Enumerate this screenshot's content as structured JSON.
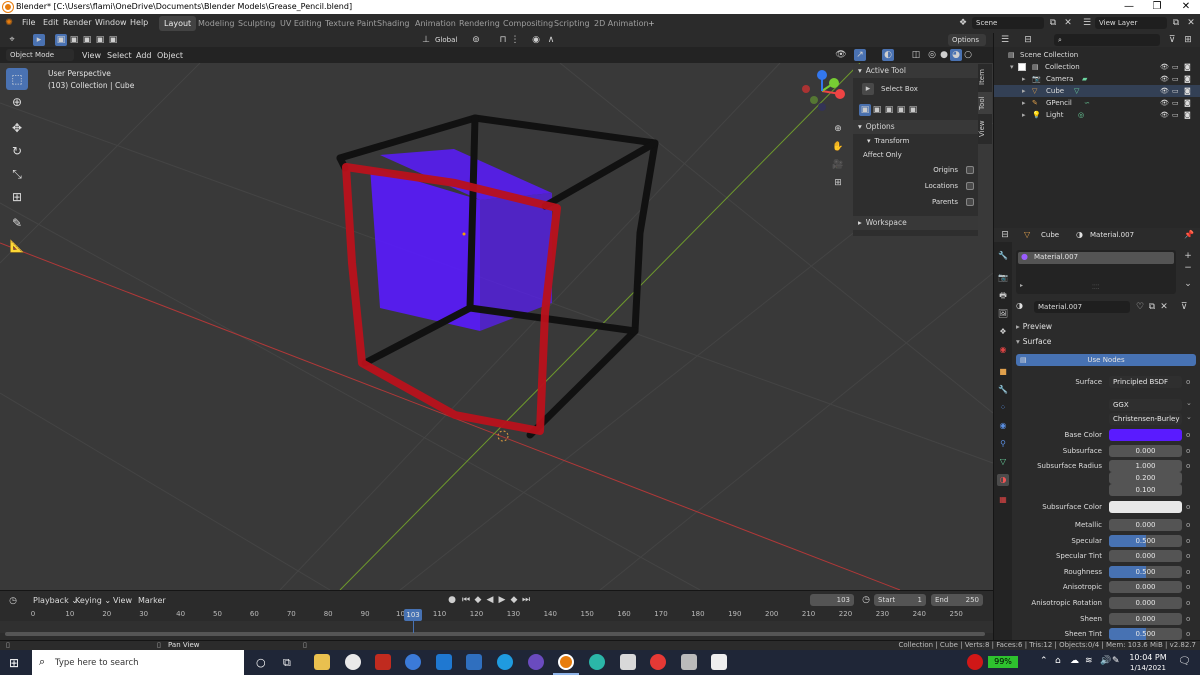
{
  "window": {
    "title": "Blender* [C:\\Users\\flami\\OneDrive\\Documents\\Blender Models\\Grease_Pencil.blend]",
    "controls": [
      "—",
      "❐",
      "✕"
    ]
  },
  "menu": [
    "File",
    "Edit",
    "Render",
    "Window",
    "Help"
  ],
  "workspaces": [
    "Layout",
    "Modeling",
    "Sculpting",
    "UV Editing",
    "Texture Paint",
    "Shading",
    "Animation",
    "Rendering",
    "Compositing",
    "Scripting",
    "2D Animation"
  ],
  "active_workspace": "Layout",
  "scene": {
    "name": "Scene",
    "view_layer": "View Layer"
  },
  "viewport": {
    "orientation": "Global",
    "options_label": "Options",
    "mode": "Object Mode",
    "header_menu": [
      "View",
      "Select",
      "Add",
      "Object"
    ],
    "info_line1": "User Perspective",
    "info_line2": "(103) Collection | Cube",
    "background": "#393939",
    "cube_color": "#5a1bff"
  },
  "toolbar_icons": [
    "select-box-icon",
    "cursor-icon",
    "move-icon",
    "rotate-icon",
    "scale-icon",
    "transform-icon",
    "annotate-icon",
    "measure-icon"
  ],
  "npanel": {
    "active_tool_label": "Active Tool",
    "select_box_label": "Select Box",
    "options_label": "Options",
    "transform_label": "Transform",
    "affect_only_label": "Affect Only",
    "origins_label": "Origins",
    "locations_label": "Locations",
    "parents_label": "Parents",
    "workspace_label": "Workspace",
    "tabs": [
      "Item",
      "Tool",
      "View"
    ]
  },
  "outliner": {
    "scene_collection": "Scene Collection",
    "collection": "Collection",
    "items": [
      {
        "name": "Camera",
        "icon": "camera-icon",
        "color": "#e0a04c"
      },
      {
        "name": "Cube",
        "icon": "mesh-icon",
        "color": "#e0a04c"
      },
      {
        "name": "GPencil",
        "icon": "grease-pencil-icon",
        "color": "#e0a04c"
      },
      {
        "name": "Light",
        "icon": "light-icon",
        "color": "#e0a04c"
      }
    ]
  },
  "properties": {
    "object_name": "Cube",
    "material_name": "Material.007",
    "slot_name": "Material.007",
    "preview_label": "Preview",
    "surface_label": "Surface",
    "use_nodes_label": "Use Nodes",
    "surface_shader_label": "Surface",
    "surface_shader_value": "Principled BSDF",
    "distribution": "GGX",
    "subsurface_method": "Christensen-Burley",
    "base_color_label": "Base Color",
    "base_color": "#5a1bff",
    "subsurface_color": "#e8e8e8",
    "rows": [
      {
        "label": "Subsurface",
        "value": "0.000",
        "fill": 0
      },
      {
        "label": "Subsurface Radius",
        "value": "1.000",
        "fill": 0
      },
      {
        "label": "",
        "value": "0.200",
        "fill": 0
      },
      {
        "label": "",
        "value": "0.100",
        "fill": 0
      }
    ],
    "subsurface_color_label": "Subsurface Color",
    "rows2": [
      {
        "label": "Metallic",
        "value": "0.000",
        "fill": 0
      },
      {
        "label": "Specular",
        "value": "0.500",
        "fill": 0.5
      },
      {
        "label": "Specular Tint",
        "value": "0.000",
        "fill": 0
      },
      {
        "label": "Roughness",
        "value": "0.500",
        "fill": 0.5
      },
      {
        "label": "Anisotropic",
        "value": "0.000",
        "fill": 0
      },
      {
        "label": "Anisotropic Rotation",
        "value": "0.000",
        "fill": 0
      },
      {
        "label": "Sheen",
        "value": "0.000",
        "fill": 0
      },
      {
        "label": "Sheen Tint",
        "value": "0.500",
        "fill": 0.5
      }
    ]
  },
  "timeline": {
    "menu": [
      "Playback",
      "Keying",
      "View",
      "Marker"
    ],
    "current_frame": "103",
    "start_label": "Start",
    "start": "1",
    "end_label": "End",
    "end": "250",
    "ticks": [
      "0",
      "10",
      "20",
      "30",
      "40",
      "50",
      "60",
      "70",
      "80",
      "90",
      "100",
      "110",
      "120",
      "130",
      "140",
      "150",
      "160",
      "170",
      "180",
      "190",
      "200",
      "210",
      "220",
      "230",
      "240",
      "250"
    ],
    "playhead_label": "103"
  },
  "statusbar": {
    "hint": "Pan View",
    "stats": "Collection | Cube | Verts:8 | Faces:6 | Tris:12 | Objects:0/4 | Mem: 103.6 MiB | v2.82.7"
  },
  "taskbar": {
    "search_placeholder": "Type here to search",
    "battery": "99%",
    "time": "10:04 PM",
    "date": "1/14/2021"
  }
}
